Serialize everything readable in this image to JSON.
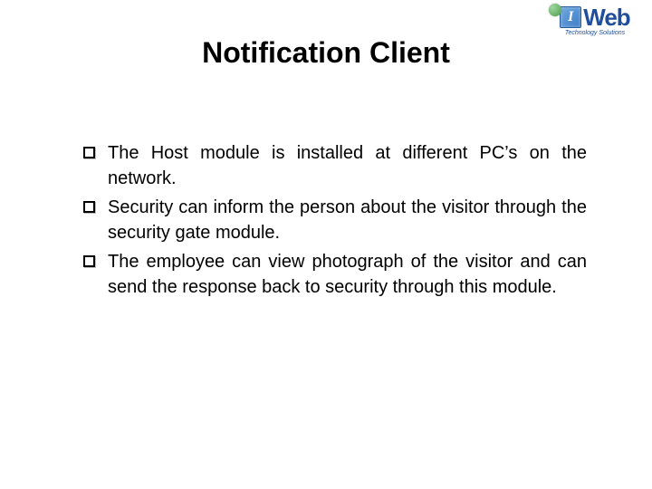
{
  "title": "Notification Client",
  "logo": {
    "top_text": "",
    "letter": "I",
    "word": "Web",
    "tagline": "Technology Solutions"
  },
  "bullets": [
    "The Host module is installed at different  PC’s on the network.",
    "Security can inform the person about the visitor through the security gate module.",
    "The employee can view photograph of the visitor and can send the response back to security through this module."
  ]
}
